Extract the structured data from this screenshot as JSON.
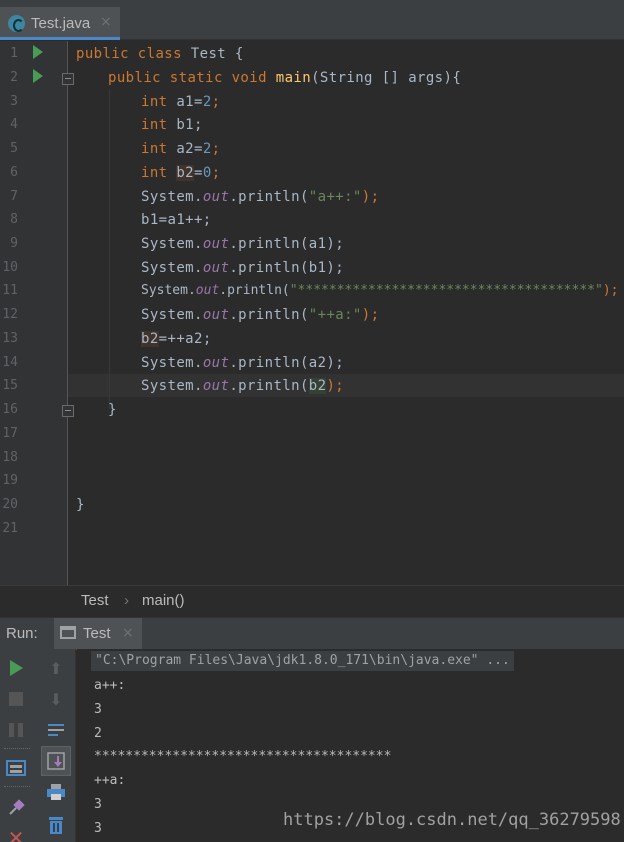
{
  "tab": {
    "label": "Test.java",
    "close": "×"
  },
  "editor": {
    "line_numbers": [
      "1",
      "2",
      "3",
      "4",
      "5",
      "6",
      "7",
      "8",
      "9",
      "10",
      "11",
      "12",
      "13",
      "14",
      "15",
      "16",
      "17",
      "18",
      "19",
      "20",
      "21"
    ],
    "lines": [
      [
        "public class ",
        "Test {"
      ],
      [
        "public static void ",
        "main",
        "(String [] args){"
      ],
      [
        "int ",
        "a1=",
        "2",
        ";"
      ],
      [
        "int ",
        "b1;"
      ],
      [
        "int ",
        "a2=",
        "2",
        ";"
      ],
      [
        "int ",
        "b2",
        "=",
        "0",
        ";"
      ],
      [
        "System.",
        "out",
        ".println(",
        "\"a++:\"",
        ");"
      ],
      [
        "b1=a1++;"
      ],
      [
        "System.",
        "out",
        ".println(a1);"
      ],
      [
        "System.",
        "out",
        ".println(b1);"
      ],
      [
        "System.",
        "out",
        ".println(",
        "\"**************************************\"",
        ");"
      ],
      [
        "System.",
        "out",
        ".println(",
        "\"++a:\"",
        ");"
      ],
      [
        "b2",
        "=++a2;"
      ],
      [
        "System.",
        "out",
        ".println(a2);"
      ],
      [
        "System.",
        "out",
        ".println(",
        "b2",
        ");"
      ],
      [
        "}"
      ],
      [
        "}"
      ]
    ]
  },
  "breadcrumb": {
    "class": "Test",
    "sep": "›",
    "method": "main()"
  },
  "run_panel": {
    "label": "Run:",
    "tab_label": "Test",
    "tab_close": "×"
  },
  "console": {
    "command": "\"C:\\Program Files\\Java\\jdk1.8.0_171\\bin\\java.exe\" ...",
    "output": [
      "a++:",
      "3",
      "2",
      "**************************************",
      "++a:",
      "3",
      "3"
    ]
  },
  "watermark": "https://blog.csdn.net/qq_36279598",
  "colors": {
    "keyword": "#CC7832",
    "method": "#FFC66D",
    "number": "#6897BB",
    "string": "#6A8759",
    "field": "#9876AA",
    "run_green": "#499C54"
  }
}
